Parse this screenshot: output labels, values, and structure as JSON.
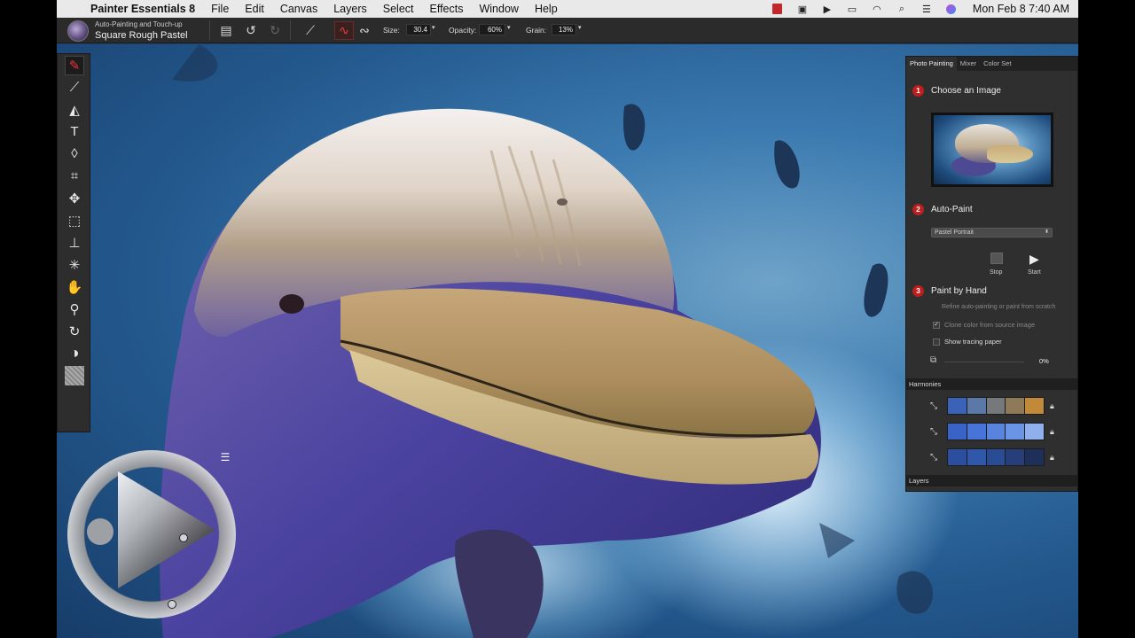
{
  "menubar": {
    "app_name": "Painter Essentials 8",
    "menus": [
      "File",
      "Edit",
      "Canvas",
      "Layers",
      "Select",
      "Effects",
      "Window",
      "Help"
    ],
    "clock": "Mon Feb 8  7:40 AM"
  },
  "propbar": {
    "brush_category": "Auto-Painting and Touch-up",
    "brush_variant": "Square Rough Pastel",
    "size_label": "Size:",
    "size_value": "30.4",
    "opacity_label": "Opacity:",
    "opacity_value": "60%",
    "grain_label": "Grain:",
    "grain_value": "13%"
  },
  "toolbox": {
    "tools": [
      "brush-tool",
      "dropper-tool",
      "paint-bucket-tool",
      "text-tool",
      "eraser-tool",
      "crop-tool",
      "transform-tool",
      "rectangular-selection-tool",
      "cloner-tool",
      "magic-wand-tool",
      "grabber-tool",
      "magnifier-tool",
      "rotate-page-tool",
      "main-secondary-color",
      "paper-texture"
    ]
  },
  "panel": {
    "tabs": [
      "Photo Painting",
      "Mixer",
      "Color Set"
    ],
    "step1": {
      "num": "1",
      "label": "Choose an Image"
    },
    "step2": {
      "num": "2",
      "label": "Auto-Paint"
    },
    "auto_paint_select": "Pastel Portrait",
    "stop_label": "Stop",
    "start_label": "Start",
    "step3": {
      "num": "3",
      "label": "Paint by Hand"
    },
    "refine_text": "Refine auto-painting or paint from scratch",
    "clone_color_label": "Clone color from source image",
    "clone_color_checked": true,
    "show_tracing_label": "Show tracing paper",
    "show_tracing_checked": false,
    "tracing_opacity": "0%",
    "harmonies_title": "Harmonies",
    "harmonies": [
      [
        "#3a63b8",
        "#5a78a8",
        "#75797c",
        "#8e7a58",
        "#c08a3a"
      ],
      [
        "#3a63c8",
        "#4674d8",
        "#5884e0",
        "#6a94e6",
        "#8fb0ec"
      ],
      [
        "#2b4f9e",
        "#2f57aa",
        "#2a4c94",
        "#263f7a",
        "#1e2f5a"
      ]
    ],
    "layers_title": "Layers"
  },
  "colors": {
    "accent_red": "#c01e1e"
  }
}
